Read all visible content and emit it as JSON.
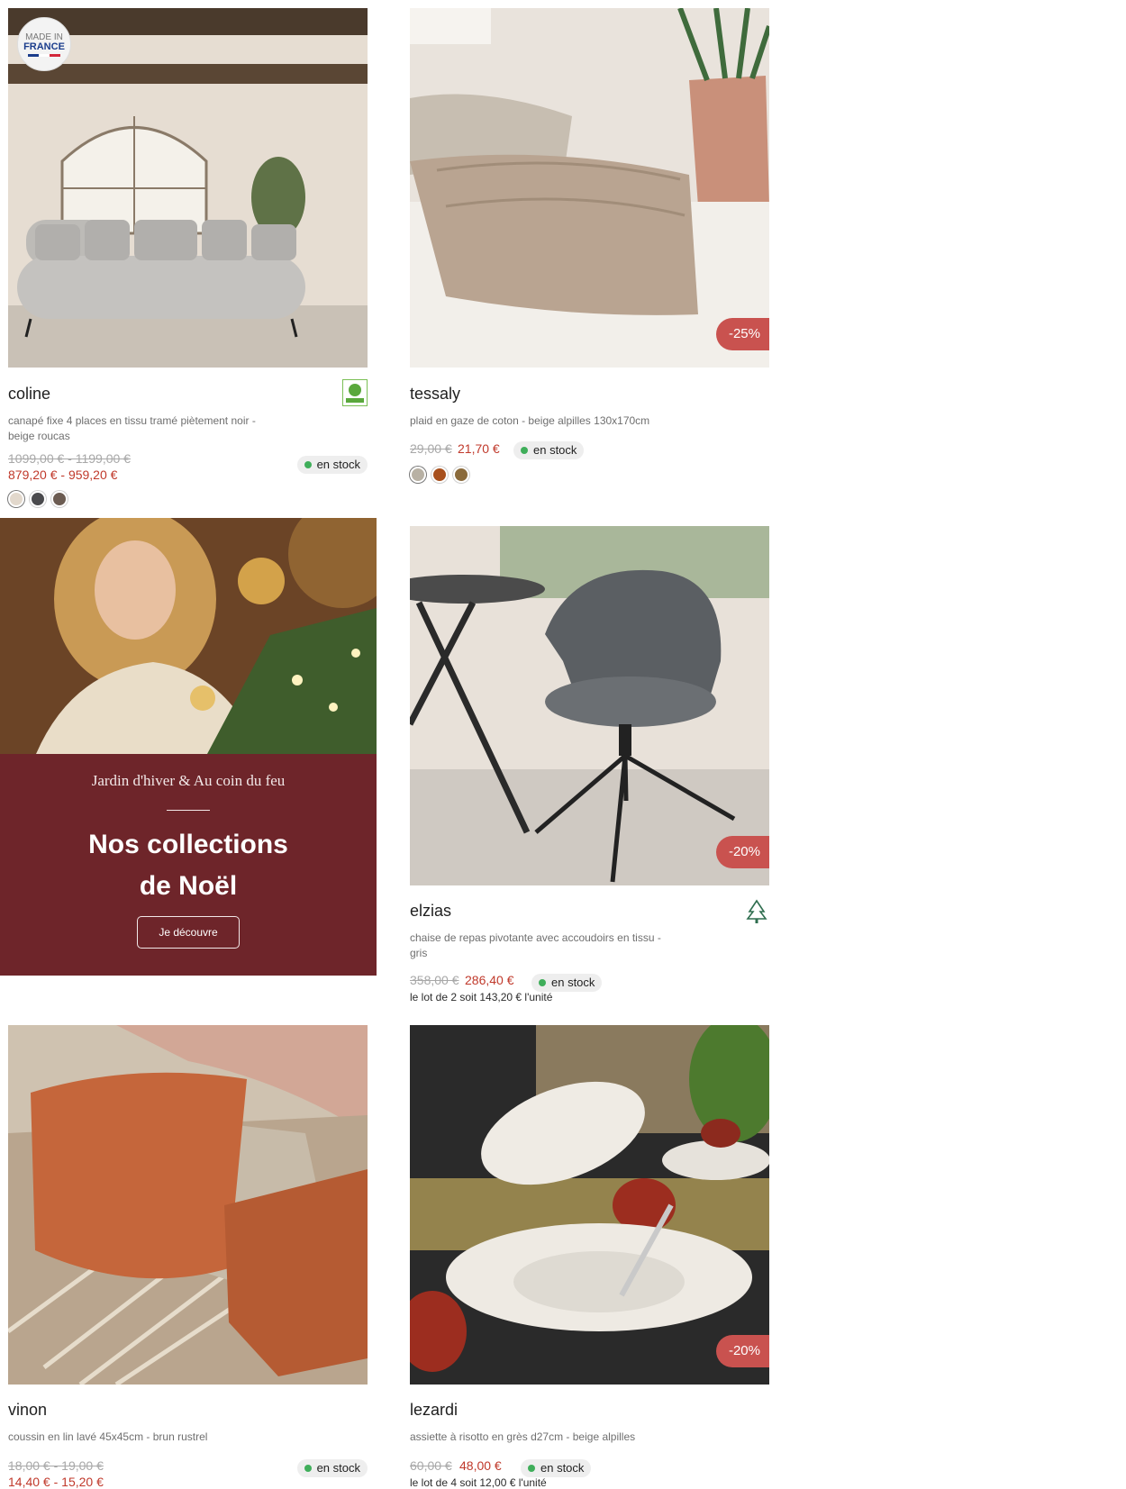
{
  "products": [
    {
      "name": "coline",
      "description": "canapé fixe 4 places en tissu tramé piètement noir - beige roucas",
      "price_old": "1099,00 € - 1199,00 €",
      "price_new": "879,20 € - 959,20 €",
      "stock": "en stock",
      "badge_made_in": "MADE IN",
      "badge_country": "FRANCE",
      "certification": "PEFC",
      "swatches": [
        "#e2d8cc",
        "#4a4a4d",
        "#6c5c52"
      ]
    },
    {
      "name": "tessaly",
      "description": "plaid en gaze de coton - beige alpilles 130x170cm",
      "price_old": "29,00 €",
      "price_new": "21,70 €",
      "stock": "en stock",
      "discount": "-25%",
      "swatches": [
        "#b8b1a4",
        "#a8501d",
        "#8a6a3b"
      ]
    },
    {
      "name": "elzias",
      "description": "chaise de repas pivotante avec accoudoirs en tissu - gris",
      "price_old": "358,00 €",
      "price_new": "286,40 €",
      "stock": "en stock",
      "discount": "-20%",
      "certification": "FSC",
      "lot": "le lot de 2 soit 143,20 € l'unité"
    },
    {
      "name": "vinon",
      "description": "coussin en lin lavé 45x45cm - brun rustrel",
      "price_old": "18,00 € - 19,00 €",
      "price_new": "14,40 € - 15,20 €",
      "stock": "en stock"
    },
    {
      "name": "lezardi",
      "description": "assiette à risotto en grès d27cm - beige alpilles",
      "price_old": "60,00 €",
      "price_new": "48,00 €",
      "stock": "en stock",
      "discount": "-20%",
      "lot": "le lot de 4 soit 12,00 € l'unité"
    }
  ],
  "promo": {
    "subtitle": "Jardin d'hiver & Au coin du feu",
    "title_line1": "Nos collections",
    "title_line2": "de Noël",
    "button": "Je découvre"
  },
  "colors": {
    "discount_badge": "#c9524f",
    "price_new": "#c0392b",
    "promo_band": "#6e252a",
    "stock_dot": "#3fae5a"
  }
}
